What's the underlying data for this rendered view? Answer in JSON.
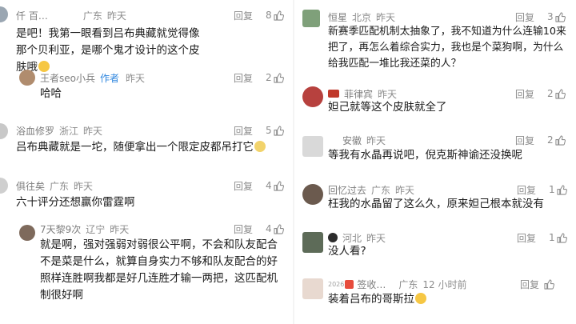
{
  "left": [
    {
      "author": "仟 百…",
      "location": "广东",
      "time": "昨天",
      "reply": "回复",
      "likes": "8",
      "text": "是吧！我第一眼看到吕布典藏就觉得像那个贝利亚，是哪个鬼才设计的这个皮肤哦",
      "avatar_color": "#9aa6b2",
      "text_emoji": "face-icon"
    },
    {
      "author": "王者seo小兵",
      "tag": "作者",
      "time": "昨天",
      "reply": "回复",
      "likes": "2",
      "text": "哈哈",
      "avatar_color": "#b08c6e"
    },
    {
      "author": "浴血修罗",
      "location": "浙江",
      "time": "昨天",
      "reply": "回复",
      "likes": "5",
      "text": "吕布典藏就是一坨，随便拿出一个限定皮都吊打它",
      "avatar_color": "#c8c8c8",
      "text_emoji": "cat-face-icon"
    },
    {
      "author": "俱往矣",
      "location": "广东",
      "time": "昨天",
      "reply": "回复",
      "likes": "4",
      "text": "六十评分还想赢你雷霆啊",
      "avatar_color": "#cfcfcf"
    },
    {
      "author": "7天黎9次",
      "location": "辽宁",
      "time": "昨天",
      "reply": "回复",
      "likes": "4",
      "text": "就是啊，强对强弱对弱很公平啊，不会和队友配合不是菜是什么，就算自身实力不够和队友配合的好照样连胜啊我都是好几连胜才输一两把，这匹配机制很好啊",
      "avatar_color": "#7e6a5c"
    }
  ],
  "right": [
    {
      "author": "恒星",
      "location": "北京",
      "time": "昨天",
      "reply": "回复",
      "likes": "3",
      "text": "新赛季匹配机制太抽象了，我不知道为什么连输10来把了，再怎么着综合实力，我也是个菜狗啊，为什么给我匹配一堆比我还菜的人？",
      "avatar_color": "#7fa07a"
    },
    {
      "author": "菲律宾",
      "time": "昨天",
      "reply": "回复",
      "likes": "2",
      "text": "妲己就等这个皮肤就全了",
      "avatar_color": "#b7413e"
    },
    {
      "author": "安徽",
      "time": "昨天",
      "reply": "回复",
      "likes": "2",
      "text": "等我有水晶再说吧，倪克斯神谕还没换呢",
      "avatar_color": "#d9d9d9"
    },
    {
      "author": "回忆过去",
      "location": "广东",
      "time": "昨天",
      "reply": "回复",
      "likes": "1",
      "text": "枉我的水晶留了这么久，原来妲己根本就没有",
      "avatar_color": "#6b5a4e"
    },
    {
      "author": "河北",
      "time": "昨天",
      "reply": "回复",
      "likes": "1",
      "text": "没人看?",
      "avatar_color": "#5d6b58"
    },
    {
      "author": "签收…",
      "author_prefix": "2026",
      "location": "广东",
      "time": "12 小时前",
      "reply": "回复",
      "likes": "",
      "text": "装着吕布的哥斯拉",
      "avatar_color": "#e8d9d0",
      "text_emoji": "face-icon"
    }
  ]
}
